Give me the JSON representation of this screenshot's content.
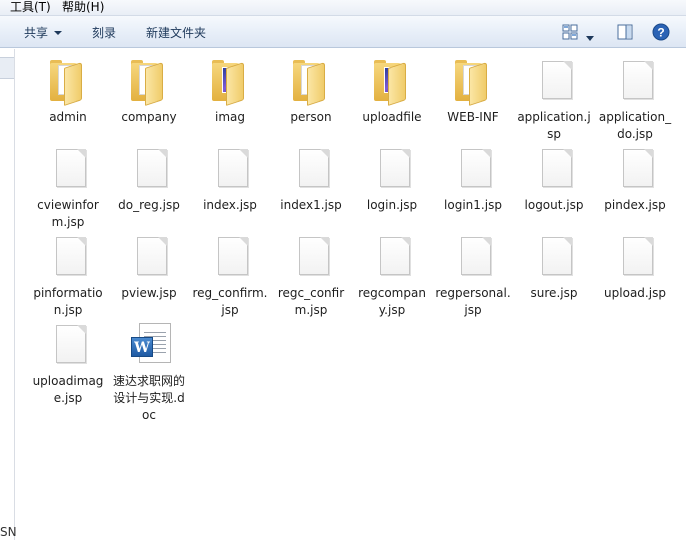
{
  "menu": {
    "tools": "工具(T)",
    "help": "帮助(H)"
  },
  "toolbar": {
    "share": "共享",
    "burn": "刻录",
    "new_folder": "新建文件夹",
    "icons": [
      "view-options-icon",
      "dropdown-arrow-icon",
      "preview-pane-icon",
      "help-icon"
    ]
  },
  "left_pane": {
    "truncated_text": "SN"
  },
  "files": [
    {
      "name": "admin",
      "type": "folder"
    },
    {
      "name": "company",
      "type": "folder"
    },
    {
      "name": "imag",
      "type": "folder-image"
    },
    {
      "name": "person",
      "type": "folder"
    },
    {
      "name": "uploadfile",
      "type": "folder-image"
    },
    {
      "name": "WEB-INF",
      "type": "folder"
    },
    {
      "name": "application.jsp",
      "type": "file"
    },
    {
      "name": "application_do.jsp",
      "type": "file"
    },
    {
      "name": "cviewinform.jsp",
      "type": "file"
    },
    {
      "name": "do_reg.jsp",
      "type": "file"
    },
    {
      "name": "index.jsp",
      "type": "file"
    },
    {
      "name": "index1.jsp",
      "type": "file"
    },
    {
      "name": "login.jsp",
      "type": "file"
    },
    {
      "name": "login1.jsp",
      "type": "file"
    },
    {
      "name": "logout.jsp",
      "type": "file"
    },
    {
      "name": "pindex.jsp",
      "type": "file"
    },
    {
      "name": "pinformation.jsp",
      "type": "file"
    },
    {
      "name": "pview.jsp",
      "type": "file"
    },
    {
      "name": "reg_confirm.jsp",
      "type": "file"
    },
    {
      "name": "regc_confirm.jsp",
      "type": "file"
    },
    {
      "name": "regcompany.jsp",
      "type": "file"
    },
    {
      "name": "regpersonal.jsp",
      "type": "file"
    },
    {
      "name": "sure.jsp",
      "type": "file"
    },
    {
      "name": "upload.jsp",
      "type": "file"
    },
    {
      "name": "uploadimage.jsp",
      "type": "file"
    },
    {
      "name": "速达求职网的设计与实现.doc",
      "type": "doc",
      "badge": "W"
    }
  ]
}
